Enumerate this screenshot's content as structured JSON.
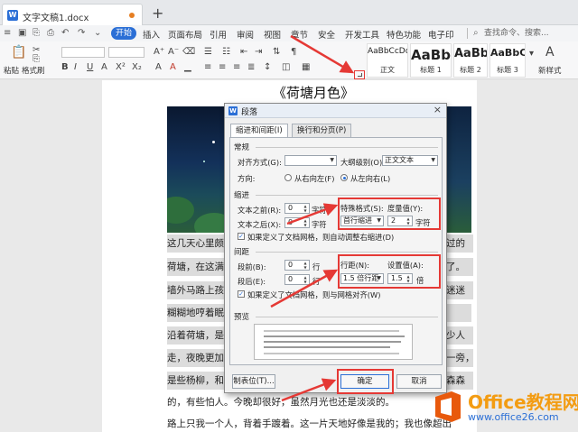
{
  "window": {
    "doc_tab_label": "文字文稿1.docx",
    "doc_icon_text": "W",
    "new_tab": "+"
  },
  "menu": {
    "start": "开始",
    "items": [
      "插入",
      "页面布局",
      "引用",
      "审阅",
      "视图",
      "章节",
      "安全",
      "开发工具",
      "特色功能",
      "电子印"
    ],
    "search": "查找命令、搜索..."
  },
  "ribbon": {
    "paste_label": "粘贴",
    "format_painter_label": "格式刷",
    "new_style_label": "新样式",
    "styles": [
      {
        "sample": "AaBbCcDd",
        "name": "正文"
      },
      {
        "sample": "AaBb",
        "name": "标题 1"
      },
      {
        "sample": "AaBb(",
        "name": "标题 2"
      },
      {
        "sample": "AaBbC",
        "name": "标题 3"
      }
    ]
  },
  "document": {
    "title": "《荷塘月色》",
    "lines": [
      "这几天心里颇",
      "荷塘，在这满",
      "墙外马路上孩",
      "糊糊地哼着眠",
      "沿着荷塘，是",
      "走，夜晚更加",
      "是些杨柳，和",
      "的，有些怕人。今晚却很好，虽然月光也还是淡淡的。",
      "路上只我一个人，背着手踱着。这一片天地好像是我的；我也像超出"
    ],
    "right_lines": [
      "过的",
      "了。",
      "迷迷",
      "",
      "少人",
      "一旁，",
      "森森"
    ]
  },
  "dialog": {
    "icon_text": "W",
    "title": "段落",
    "close": "×",
    "tabs": [
      "缩进和间距(I)",
      "换行和分页(P)"
    ],
    "general": {
      "section": "常规",
      "align_label": "对齐方式(G):",
      "align_value": "",
      "outline_label": "大纲级别(O):",
      "outline_value": "正文文本",
      "direction_label": "方向:",
      "rtl_label": "从右向左(F)",
      "ltr_label": "从左向右(L)"
    },
    "indent": {
      "section": "缩进",
      "before_label": "文本之前(R):",
      "before_value": "0",
      "before_unit": "字符",
      "after_label": "文本之后(X):",
      "after_value": "0",
      "after_unit": "字符",
      "special_label": "特殊格式(S):",
      "special_value": "首行缩进",
      "measure_label": "度量值(Y):",
      "measure_value": "2",
      "measure_unit": "字符",
      "grid_check": "如果定义了文档网格，则自动调整右缩进(D)"
    },
    "spacing": {
      "section": "间距",
      "before_label": "段前(B):",
      "before_value": "0",
      "before_unit": "行",
      "after_label": "段后(E):",
      "after_value": "0",
      "after_unit": "行",
      "line_label": "行距(N):",
      "line_value": "1.5 倍行距",
      "setting_label": "设置值(A):",
      "setting_value": "1.5",
      "setting_unit": "倍",
      "grid_check": "如果定义了文档网格，则与网格对齐(W)"
    },
    "preview_label": "预览",
    "tabs_button": "制表位(T)...",
    "ok": "确定",
    "cancel": "取消"
  },
  "watermark": {
    "brand": "Office教程网",
    "url": "www.office26.com"
  },
  "colors": {
    "accent": "#2b6fd6",
    "highlight": "#e53935",
    "watermark_orange": "#f39c12"
  }
}
